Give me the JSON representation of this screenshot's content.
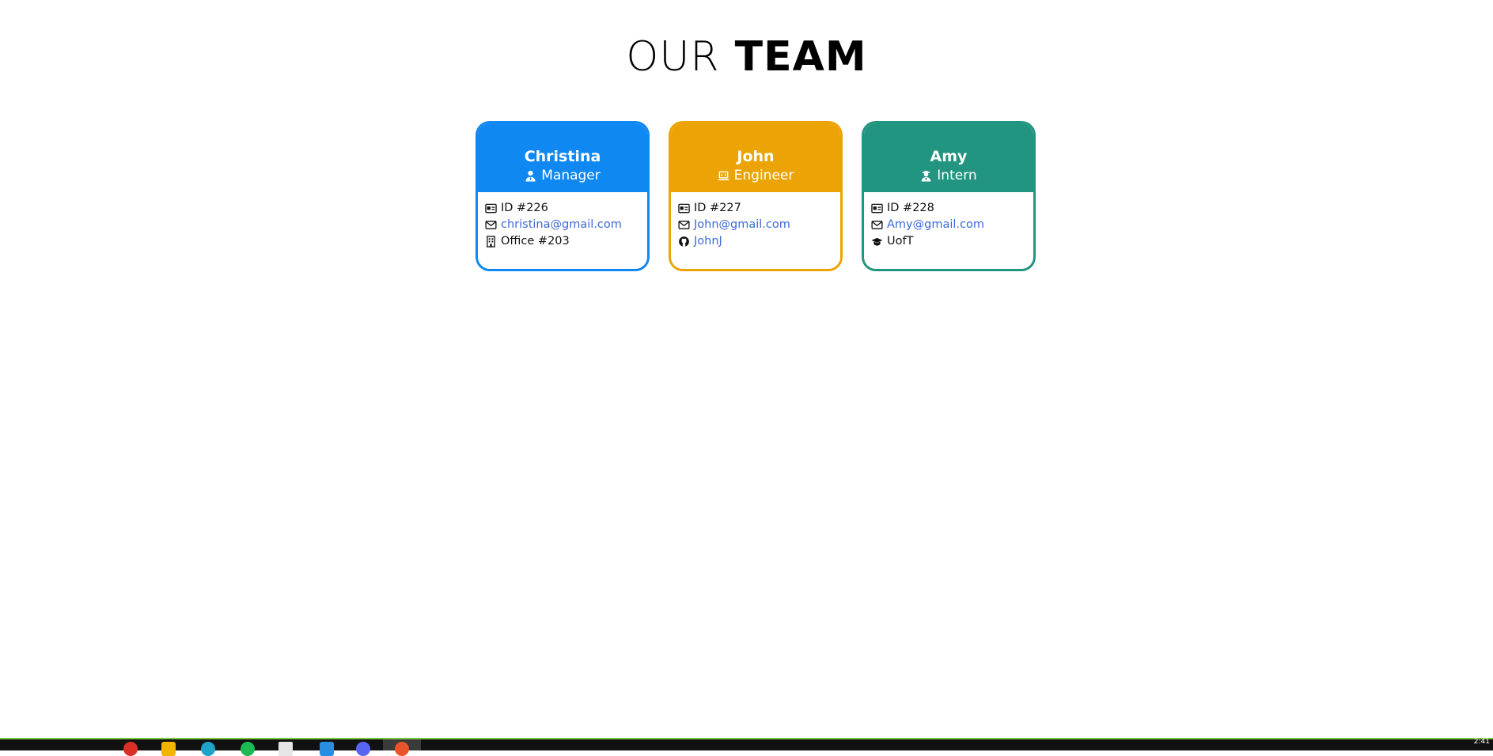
{
  "title": {
    "light": "OUR",
    "bold": "TEAM"
  },
  "cards": [
    {
      "name": "Christina",
      "role": "Manager",
      "role_icon": "user-tie-icon",
      "color": "#1088f2",
      "id": "ID #226",
      "email": "christina@gmail.com",
      "extra": "Office #203",
      "extra_icon": "building-icon"
    },
    {
      "name": "John",
      "role": "Engineer",
      "role_icon": "laptop-code-icon",
      "color": "#eca306",
      "id": "ID #227",
      "email": "John@gmail.com",
      "extra": "JohnJ",
      "extra_icon": "github-icon"
    },
    {
      "name": "Amy",
      "role": "Intern",
      "role_icon": "user-graduate-icon",
      "color": "#229580",
      "id": "ID #228",
      "email": "Amy@gmail.com",
      "extra": "UofT",
      "extra_icon": "graduation-cap-icon"
    }
  ],
  "link_color": "#3b6ad6",
  "taskbar": {
    "clock": "2:41"
  }
}
